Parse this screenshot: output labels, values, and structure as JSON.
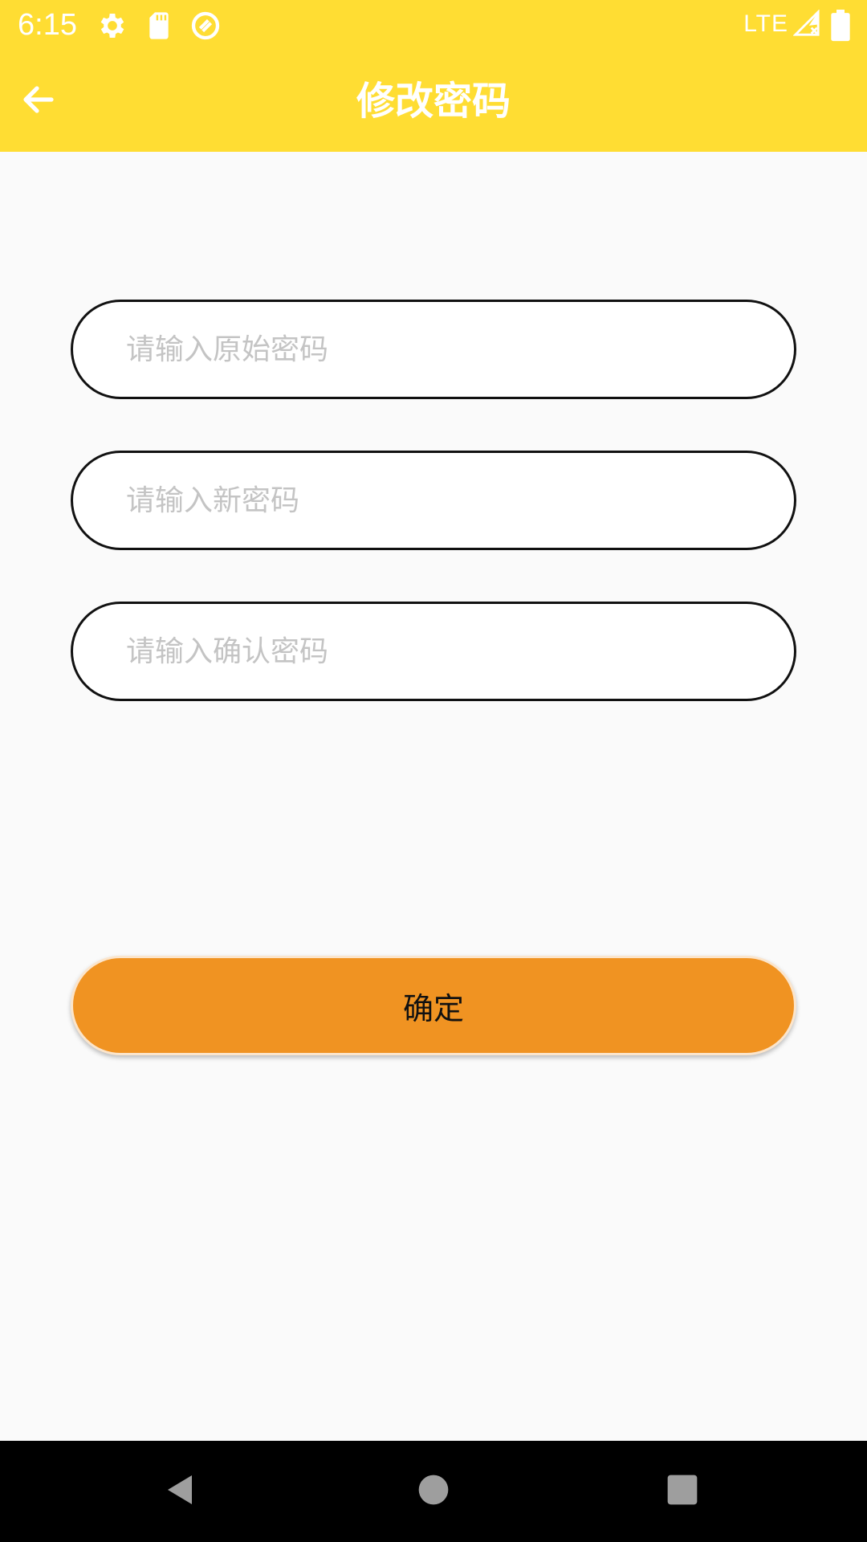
{
  "status_bar": {
    "time": "6:15",
    "network": "LTE",
    "icons": [
      "settings-icon",
      "sd-card-icon",
      "sync-icon",
      "signal-icon",
      "battery-icon"
    ]
  },
  "app_bar": {
    "title": "修改密码",
    "back_icon": "arrow-left-icon"
  },
  "form": {
    "original_password_placeholder": "请输入原始密码",
    "new_password_placeholder": "请输入新密码",
    "confirm_password_placeholder": "请输入确认密码",
    "original_password_value": "",
    "new_password_value": "",
    "confirm_password_value": ""
  },
  "confirm_button": {
    "label": "确定"
  },
  "nav_bar": {
    "icons": [
      "back-triangle-icon",
      "home-circle-icon",
      "recents-square-icon"
    ]
  },
  "colors": {
    "app_bar": "#ffdd33",
    "button": "#f09322",
    "background": "#fafafa",
    "input_border": "#111111",
    "placeholder": "#c4c4c4",
    "nav_bar": "#000000"
  }
}
